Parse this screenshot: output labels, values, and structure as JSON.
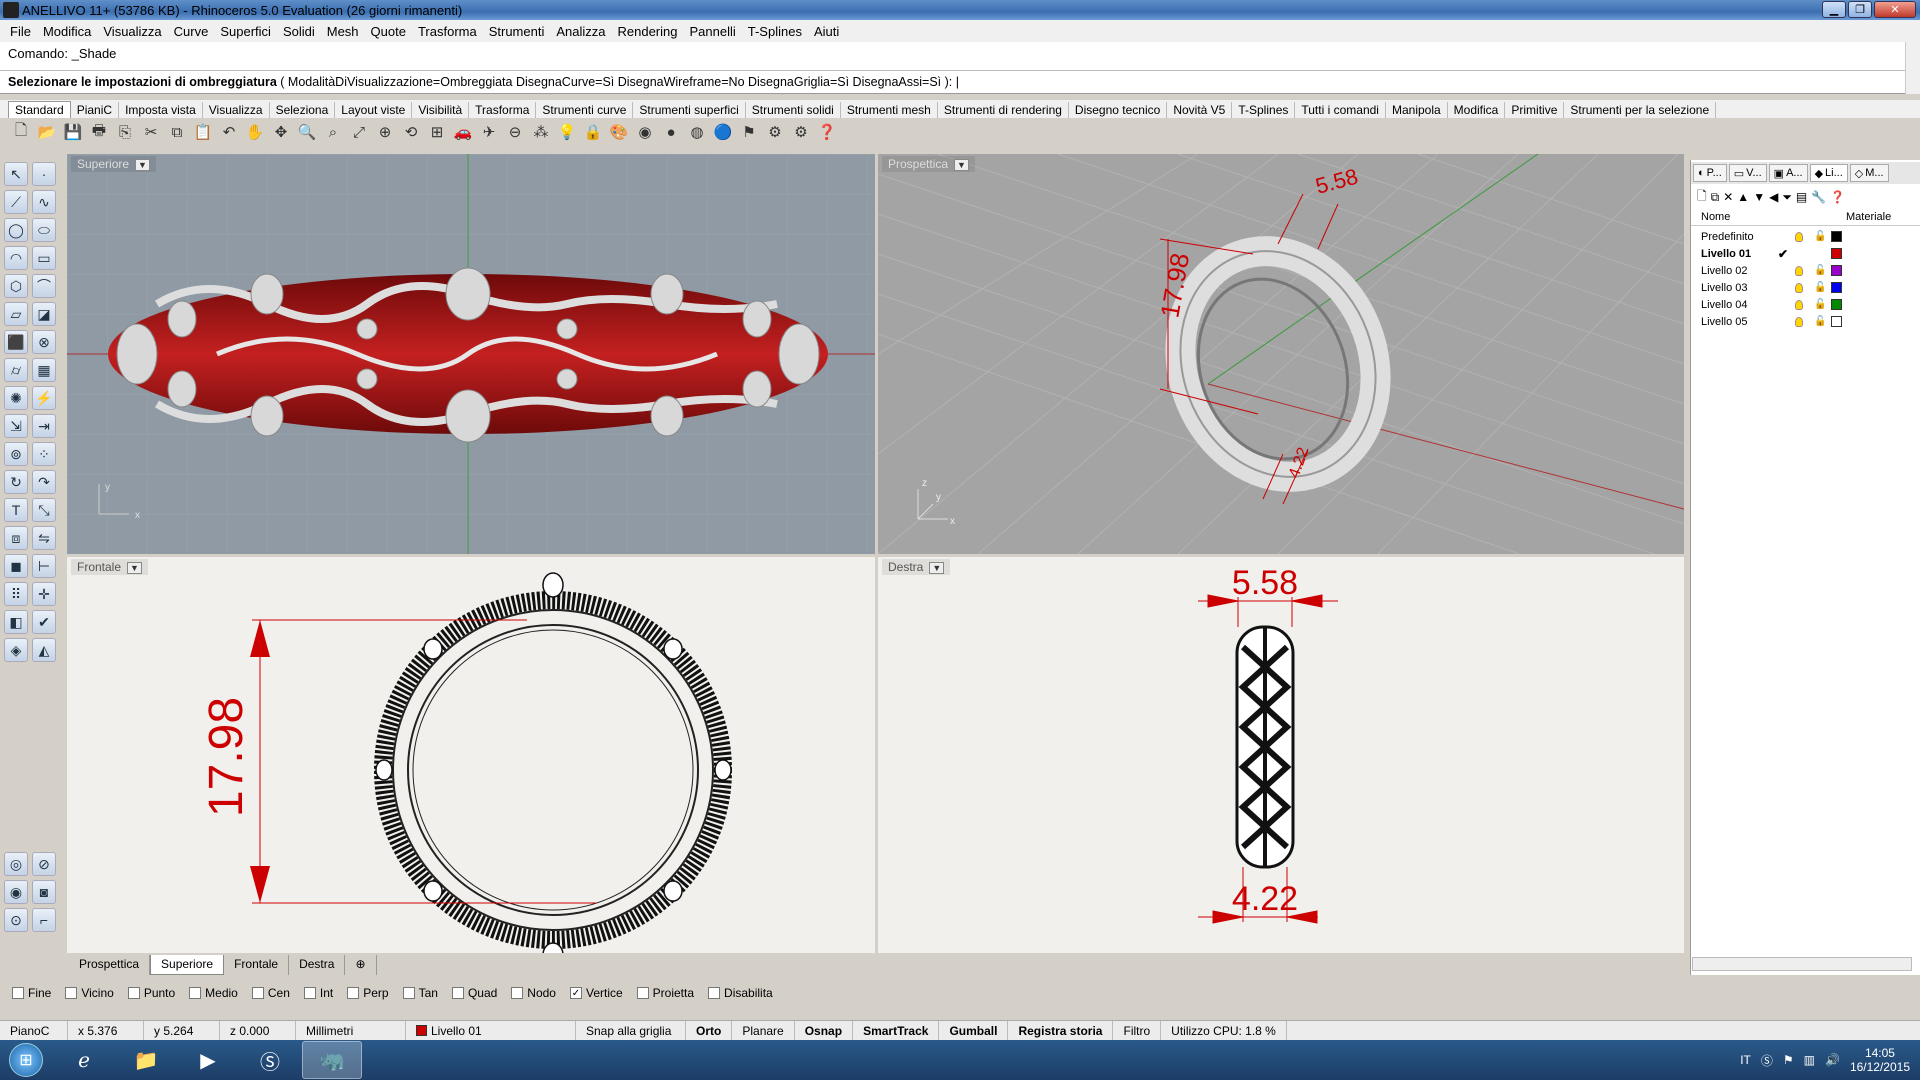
{
  "window": {
    "title": "ANELLIVO 11+ (53786 KB) - Rhinoceros 5.0 Evaluation (26 giorni rimanenti)"
  },
  "menu": [
    "File",
    "Modifica",
    "Visualizza",
    "Curve",
    "Superfici",
    "Solidi",
    "Mesh",
    "Quote",
    "Trasforma",
    "Strumenti",
    "Analizza",
    "Rendering",
    "Pannelli",
    "T-Splines",
    "Aiuti"
  ],
  "command": {
    "history": "Comando: _Shade",
    "prompt_bold": "Selezionare le impostazioni di ombreggiatura",
    "prompt_opts": "( ModalitàDiVisualizzazione=Ombreggiata  DisegnaCurve=Sì  DisegnaWireframe=No  DisegnaGriglia=Sì  DisegnaAssi=Sì ):"
  },
  "toolbar_tabs": [
    "Standard",
    "PianiC",
    "Imposta vista",
    "Visualizza",
    "Seleziona",
    "Layout viste",
    "Visibilità",
    "Trasforma",
    "Strumenti curve",
    "Strumenti superfici",
    "Strumenti solidi",
    "Strumenti mesh",
    "Strumenti di rendering",
    "Disegno tecnico",
    "Novità V5",
    "T-Splines",
    "Tutti i comandi",
    "Manipola",
    "Modifica",
    "Primitive",
    "Strumenti per la selezione"
  ],
  "viewports": {
    "top": {
      "label": "Superiore",
      "axis_y": "y",
      "axis_x": "x"
    },
    "perspective": {
      "label": "Prospettica",
      "dim_top": "5.58",
      "dim_side": "17.98",
      "dim_bottom": "4.22",
      "axis_z": "z",
      "axis_y": "y",
      "axis_x": "x"
    },
    "front": {
      "label": "Frontale",
      "dim_height": "17.98"
    },
    "right": {
      "label": "Destra",
      "dim_top": "5.58",
      "dim_bottom": "4.22"
    }
  },
  "viewport_tabs": [
    "Prospettica",
    "Superiore",
    "Frontale",
    "Destra"
  ],
  "panel": {
    "tabs": [
      "P...",
      "V...",
      "A...",
      "Li...",
      "M..."
    ],
    "col_name": "Nome",
    "col_material": "Materiale",
    "layers": [
      {
        "name": "Predefinito",
        "color": "#000000",
        "current": false
      },
      {
        "name": "Livello 01",
        "color": "#cc0000",
        "current": true
      },
      {
        "name": "Livello 02",
        "color": "#9900cc",
        "current": false
      },
      {
        "name": "Livello 03",
        "color": "#0000ee",
        "current": false
      },
      {
        "name": "Livello 04",
        "color": "#008800",
        "current": false
      },
      {
        "name": "Livello 05",
        "color": "#ffffff",
        "current": false
      }
    ],
    "current_mark": "✔"
  },
  "osnaps": [
    {
      "label": "Fine",
      "checked": false
    },
    {
      "label": "Vicino",
      "checked": false
    },
    {
      "label": "Punto",
      "checked": false
    },
    {
      "label": "Medio",
      "checked": false
    },
    {
      "label": "Cen",
      "checked": false
    },
    {
      "label": "Int",
      "checked": false
    },
    {
      "label": "Perp",
      "checked": false
    },
    {
      "label": "Tan",
      "checked": false
    },
    {
      "label": "Quad",
      "checked": false
    },
    {
      "label": "Nodo",
      "checked": false
    },
    {
      "label": "Vertice",
      "checked": true
    },
    {
      "label": "Proietta",
      "checked": false
    },
    {
      "label": "Disabilita",
      "checked": false
    }
  ],
  "status": {
    "cplane": "PianoC",
    "x": "x 5.376",
    "y": "y 5.264",
    "z": "z 0.000",
    "units": "Millimetri",
    "layer": "Livello 01",
    "layer_color": "#cc0000",
    "grid_snap": "Snap alla griglia",
    "ortho": "Orto",
    "planar": "Planare",
    "osnap": "Osnap",
    "smarttrack": "SmartTrack",
    "gumball": "Gumball",
    "history": "Registra storia",
    "filter": "Filtro",
    "cpu": "Utilizzo CPU: 1.8 %"
  },
  "taskbar": {
    "lang": "IT",
    "time": "14:05",
    "date": "16/12/2015"
  },
  "colors": {
    "ring_red": "#b01818",
    "dim_red": "#cc0000",
    "titlebar": "#3b6fb0"
  }
}
